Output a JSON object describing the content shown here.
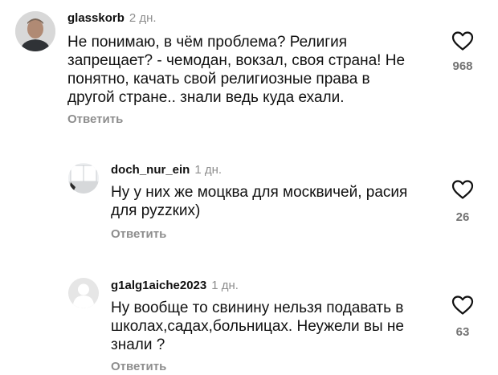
{
  "comments": [
    {
      "username": "glasskorb",
      "time": "2 дн.",
      "lines": [
        "Не понимаю,  в чём проблема? Религия",
        "запрещает? - чемодан, вокзал, своя страна! Не",
        "понятно, качать свой религиозные права в",
        "другой стране.. знали ведь куда ехали."
      ],
      "reply": "Ответить",
      "likes": "968"
    },
    {
      "username": "doch_nur_ein",
      "time": "1 дн.",
      "lines": [
        "Ну у них же моцква для москвичей, расия",
        "для руzzких)"
      ],
      "reply": "Ответить",
      "likes": "26"
    },
    {
      "username": "g1alg1aiche2023",
      "time": "1 дн.",
      "lines": [
        "Ну вообще то свинину нельзя подавать в",
        "школах,садах,больницах. Неужели вы не",
        "знали ?"
      ],
      "reply": "Ответить",
      "likes": "63"
    }
  ],
  "icons": {
    "avatar_1": "user-photo",
    "avatar_2": "window-photo",
    "avatar_3": "default-avatar",
    "like": "heart-outline-icon"
  },
  "colors": {
    "text": "#111111",
    "muted": "#8e8e8e",
    "count": "#737373"
  }
}
